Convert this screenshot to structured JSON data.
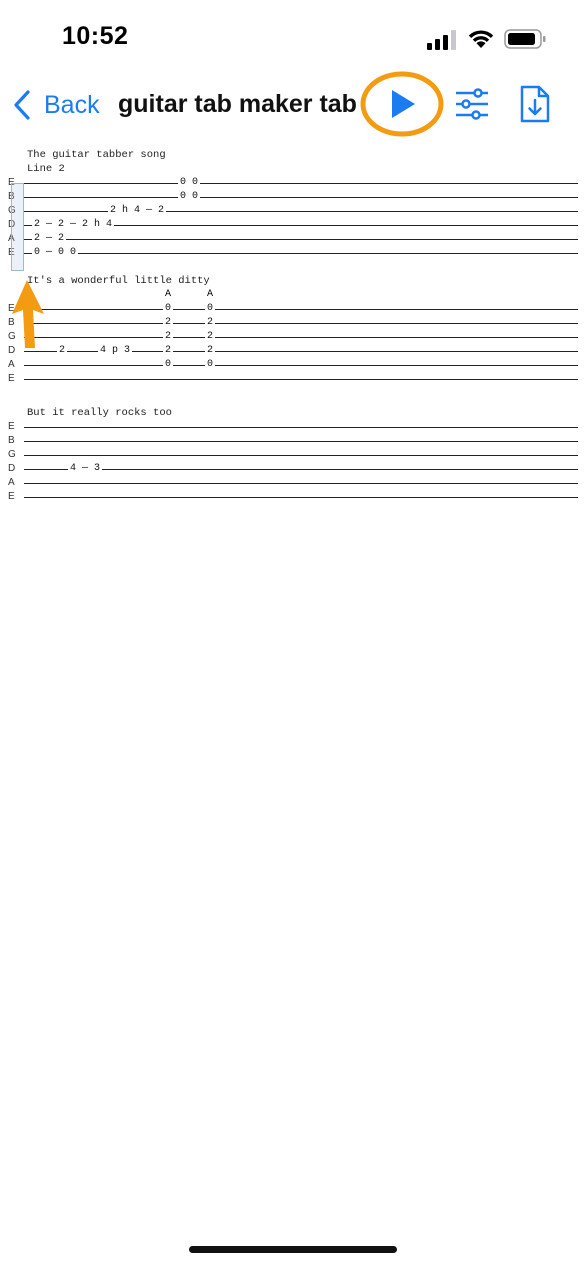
{
  "status": {
    "time": "10:52"
  },
  "nav": {
    "back_label": "Back",
    "title": "guitar tab maker tab"
  },
  "colors": {
    "accent": "#1a7cf0",
    "highlight": "#f39c12"
  },
  "icons": [
    "chevron-left-icon",
    "play-icon",
    "sliders-icon",
    "document-download-icon",
    "signal-icon",
    "wifi-icon",
    "battery-icon"
  ],
  "tab": {
    "block1": {
      "lines": [
        "The guitar tabber song",
        "Line 2"
      ],
      "strings": [
        "E",
        "B",
        "G",
        "D",
        "A",
        "E"
      ],
      "notes": [
        [
          "0 0"
        ],
        [
          "0 0"
        ],
        [
          "2 h 4 — 2"
        ],
        [
          "2 — 2 — 2 h 4"
        ],
        [
          "2 — 2"
        ],
        [
          "0 — 0 0"
        ]
      ]
    },
    "block2": {
      "title": "It's a wonderful little ditty",
      "accents": [
        "A",
        "A"
      ],
      "strings": [
        "E",
        "B",
        "G",
        "D",
        "A",
        "E"
      ],
      "notes": [
        [
          "0",
          "0"
        ],
        [
          "2",
          "2"
        ],
        [
          "2",
          "2"
        ],
        [
          "2",
          "4 p 3",
          "2",
          "2"
        ],
        [
          "0",
          "0"
        ],
        []
      ]
    },
    "block3": {
      "title": "But it really rocks too",
      "strings": [
        "E",
        "B",
        "G",
        "D",
        "A",
        "E"
      ],
      "notes": [
        [],
        [],
        [],
        [
          "4 — 3"
        ],
        [],
        []
      ]
    }
  }
}
